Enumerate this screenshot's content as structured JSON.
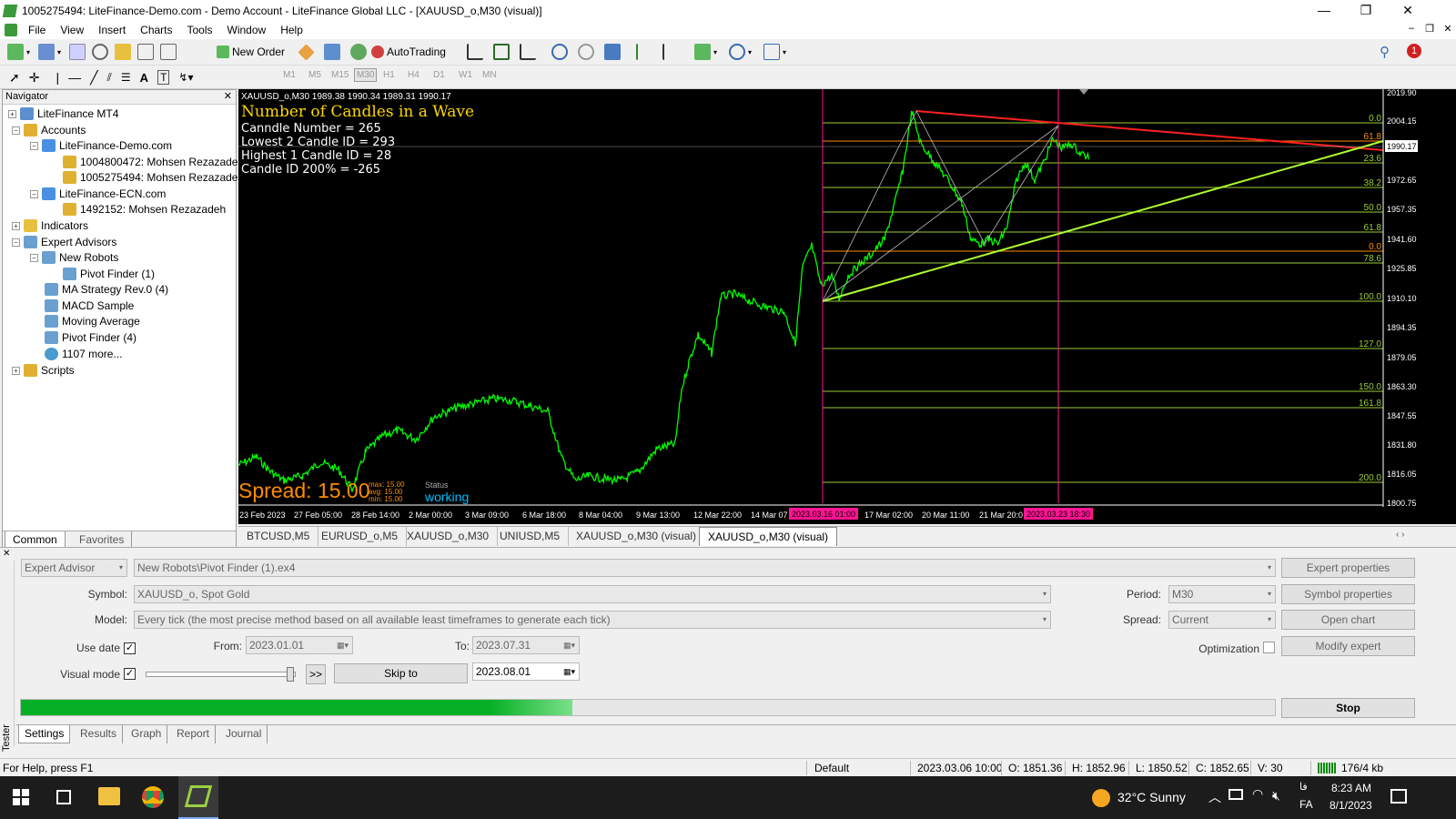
{
  "window": {
    "title": "1005275494: LiteFinance-Demo.com - Demo Account - LiteFinance Global LLC - [XAUUSD_o,M30 (visual)]",
    "minimize": "—",
    "restore": "❐",
    "close": "✕"
  },
  "menu": [
    "File",
    "View",
    "Insert",
    "Charts",
    "Tools",
    "Window",
    "Help"
  ],
  "toolbar": {
    "new_order": "New Order",
    "autotrading": "AutoTrading",
    "timeframes": [
      "M1",
      "M5",
      "M15",
      "M30",
      "H1",
      "H4",
      "D1",
      "W1",
      "MN"
    ],
    "active_timeframe": "M30",
    "alert_count": "1"
  },
  "navigator": {
    "title": "Navigator",
    "items": [
      {
        "label": "LiteFinance MT4",
        "icon": "terminal-icon"
      },
      {
        "label": "Accounts",
        "icon": "accounts-icon"
      },
      {
        "label": "LiteFinance-Demo.com",
        "icon": "server-icon"
      },
      {
        "label": "1004800472: Mohsen Rezazadeh",
        "icon": "user-icon"
      },
      {
        "label": "1005275494: Mohsen Rezazadeh",
        "icon": "user-icon"
      },
      {
        "label": "LiteFinance-ECN.com",
        "icon": "server-icon"
      },
      {
        "label": "1492152: Mohsen Rezazadeh",
        "icon": "user-icon"
      },
      {
        "label": "Indicators",
        "icon": "indicator-icon"
      },
      {
        "label": "Expert Advisors",
        "icon": "expert-icon"
      },
      {
        "label": "New Robots",
        "icon": "folder-icon"
      },
      {
        "label": "Pivot Finder (1)",
        "icon": "expert-icon"
      },
      {
        "label": "MA Strategy Rev.0 (4)",
        "icon": "expert-icon"
      },
      {
        "label": "MACD Sample",
        "icon": "expert-icon"
      },
      {
        "label": "Moving Average",
        "icon": "expert-icon"
      },
      {
        "label": "Pivot Finder (4)",
        "icon": "expert-icon"
      },
      {
        "label": "1107 more...",
        "icon": "globe-icon"
      },
      {
        "label": "Scripts",
        "icon": "script-icon"
      }
    ],
    "tabs": [
      "Common",
      "Favorites"
    ]
  },
  "chart": {
    "header": "XAUUSD_o,M30  1989.38 1990.34 1989.31 1990.17",
    "overlay_title": "Number of Candles in a Wave",
    "overlay_lines": [
      "Canndle Number = 265",
      "Lowest 2 Candle ID = 293",
      "Highest 1 Candle ID = 28",
      "Candle ID 200% = -265"
    ],
    "spread_label": "Spread: 15.00",
    "spread_stats": [
      "max: 15.00",
      "avg: 15.00",
      "min: 15.00"
    ],
    "status_label": "Status",
    "status_value": "working",
    "price_axis": [
      "2019.90",
      "2004.15",
      "1990.17",
      "1972.65",
      "1957.35",
      "1941.60",
      "1925.85",
      "1910.10",
      "1894.35",
      "1879.05",
      "1863.30",
      "1847.55",
      "1831.80",
      "1816.05",
      "1800.75"
    ],
    "current_price": "1990.17",
    "time_axis": [
      "23 Feb 2023",
      "27 Feb 05:00",
      "28 Feb 14:00",
      "2 Mar 00:00",
      "3 Mar 09:00",
      "6 Mar 18:00",
      "8 Mar 04:00",
      "9 Mar 13:00",
      "12 Mar 22:00",
      "14 Mar 07",
      "17 Mar 02:00",
      "20 Mar 11:00",
      "21 Mar 20:0"
    ],
    "time_markers": [
      "2023.03.16 01:00",
      "2023.03.23 18:30"
    ],
    "fib_levels": [
      "0.0",
      "61.8",
      "23.6",
      "38.2",
      "50.0",
      "61.8",
      "0.0",
      "78.6",
      "100.0",
      "127.0",
      "150.0",
      "161.8",
      "200.0"
    ],
    "colors": {
      "candles": "#00ff00",
      "fib": "#9acd32",
      "trendline": "#ff2020",
      "uptrend": "#adff2f",
      "marker": "#ff1493",
      "spread": "#ff8c00",
      "status": "#00bfff"
    }
  },
  "chart_tabs": [
    "BTCUSD,M5",
    "EURUSD_o,M5",
    "XAUUSD_o,M30",
    "UNIUSD,M5",
    "XAUUSD_o,M30 (visual)",
    "XAUUSD_o,M30 (visual)"
  ],
  "tester": {
    "side_label": "Tester",
    "type": "Expert Advisor",
    "expert": "New Robots\\Pivot Finder (1).ex4",
    "symbol_label": "Symbol:",
    "symbol": "XAUUSD_o, Spot Gold",
    "model_label": "Model:",
    "model": "Every tick (the most precise method based on all available least timeframes to generate each tick)",
    "use_date_label": "Use date",
    "from_label": "From:",
    "from": "2023.01.01",
    "to_label": "To:",
    "to": "2023.07.31",
    "visual_mode_label": "Visual mode",
    "ff_label": ">>",
    "skip_to_label": "Skip to",
    "skip_date": "2023.08.01",
    "period_label": "Period:",
    "period": "M30",
    "spread_label": "Spread:",
    "spread": "Current",
    "optimization_label": "Optimization",
    "buttons": {
      "expert_props": "Expert properties",
      "symbol_props": "Symbol properties",
      "open_chart": "Open chart",
      "modify_expert": "Modify expert",
      "stop": "Stop"
    },
    "progress": 0.44,
    "tabs": [
      "Settings",
      "Results",
      "Graph",
      "Report",
      "Journal"
    ]
  },
  "status": {
    "help": "For Help, press F1",
    "profile": "Default",
    "datetime": "2023.03.06 10:00",
    "open": "O: 1851.36",
    "high": "H: 1852.96",
    "low": "L: 1850.52",
    "close": "C: 1852.65",
    "volume": "V: 30",
    "traffic": "176/4 kb"
  },
  "taskbar": {
    "weather": "32°C  Sunny",
    "lang": "FA",
    "lang_top": "ﻓﺎ",
    "time": "8:23 AM",
    "date": "8/1/2023"
  }
}
